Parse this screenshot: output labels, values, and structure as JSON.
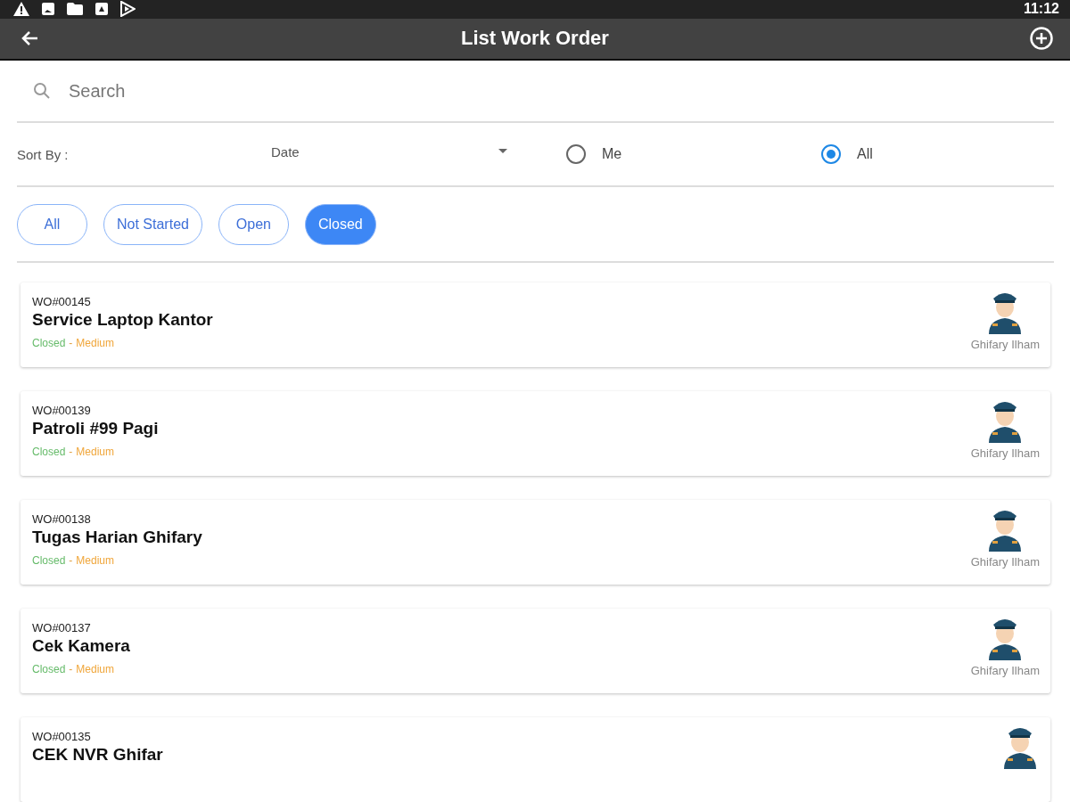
{
  "status_bar": {
    "time": "11:12"
  },
  "app_bar": {
    "title": "List Work Order"
  },
  "search": {
    "placeholder": "Search"
  },
  "sort": {
    "label": "Sort By :",
    "value": "Date"
  },
  "assignee_filter": [
    {
      "label": "Me",
      "selected": false
    },
    {
      "label": "All",
      "selected": true
    }
  ],
  "status_chips": [
    {
      "label": "All",
      "selected": false
    },
    {
      "label": "Not Started",
      "selected": false
    },
    {
      "label": "Open",
      "selected": false
    },
    {
      "label": "Closed",
      "selected": true
    }
  ],
  "work_orders": [
    {
      "code": "WO#00145",
      "title": "Service Laptop Kantor",
      "status": "Closed",
      "separator": "-",
      "priority": "Medium",
      "assignee": "Ghifary Ilham"
    },
    {
      "code": "WO#00139",
      "title": "Patroli #99 Pagi",
      "status": "Closed",
      "separator": "-",
      "priority": "Medium",
      "assignee": "Ghifary Ilham"
    },
    {
      "code": "WO#00138",
      "title": "Tugas Harian Ghifary",
      "status": "Closed",
      "separator": "-",
      "priority": "Medium",
      "assignee": "Ghifary Ilham"
    },
    {
      "code": "WO#00137",
      "title": "Cek Kamera",
      "status": "Closed",
      "separator": "-",
      "priority": "Medium",
      "assignee": "Ghifary Ilham"
    },
    {
      "code": "WO#00135",
      "title": "CEK NVR Ghifar"
    }
  ]
}
